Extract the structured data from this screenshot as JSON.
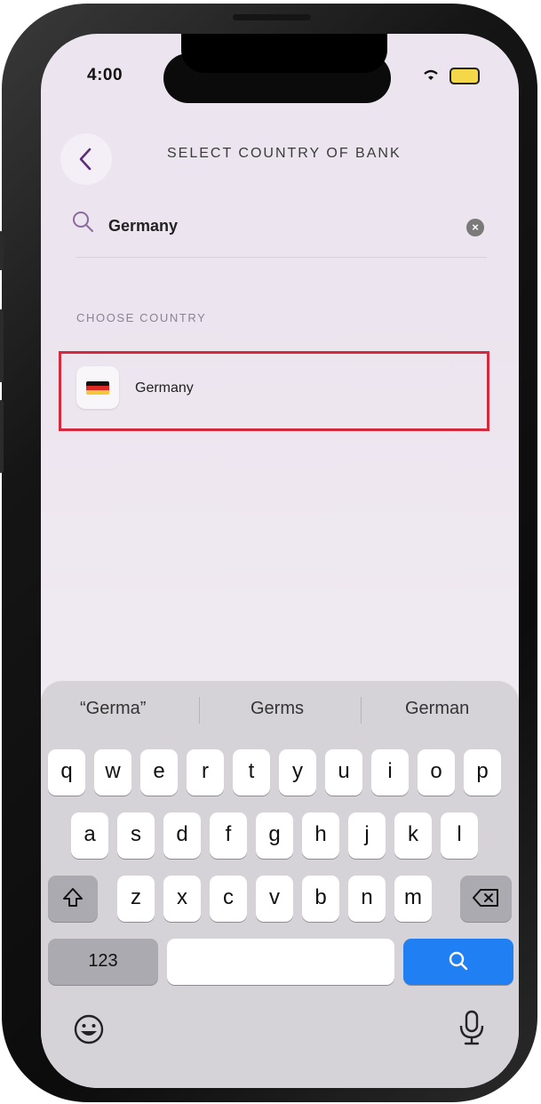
{
  "status_bar": {
    "time": "4:00"
  },
  "header": {
    "title": "SELECT COUNTRY OF BANK",
    "back_icon": "chevron-left-icon"
  },
  "search": {
    "value": "Germany",
    "icon": "search-icon",
    "clear_icon": "clear-icon"
  },
  "list": {
    "section_label": "CHOOSE COUNTRY",
    "items": [
      {
        "label": "Germany",
        "flag": "germany-flag-icon"
      }
    ]
  },
  "keyboard": {
    "suggestions": [
      "“Germa”",
      "Germs",
      "German"
    ],
    "row1": [
      "q",
      "w",
      "e",
      "r",
      "t",
      "y",
      "u",
      "i",
      "o",
      "p"
    ],
    "row2": [
      "a",
      "s",
      "d",
      "f",
      "g",
      "h",
      "j",
      "k",
      "l"
    ],
    "row3": [
      "z",
      "x",
      "c",
      "v",
      "b",
      "n",
      "m"
    ],
    "numbers_label": "123",
    "search_key_icon": "search-icon",
    "shift_icon": "shift-icon",
    "delete_icon": "backspace-icon",
    "emoji_icon": "emoji-icon",
    "mic_icon": "microphone-icon"
  },
  "colors": {
    "accent": "#5a2f78",
    "highlight": "#d32b3d",
    "search_key": "#1f7ff3"
  }
}
